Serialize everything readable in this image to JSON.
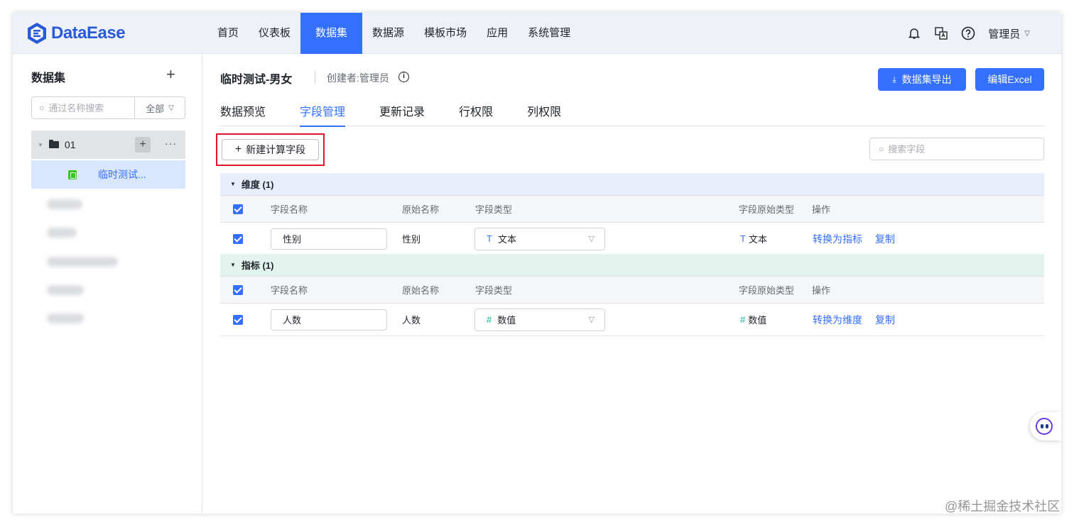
{
  "app": {
    "name": "DataEase"
  },
  "nav": {
    "items": [
      "首页",
      "仪表板",
      "数据集",
      "数据源",
      "模板市场",
      "应用",
      "系统管理"
    ],
    "active_index": 2
  },
  "topbar": {
    "user": "管理员"
  },
  "sidebar": {
    "title": "数据集",
    "search_placeholder": "通过名称搜索",
    "filter": "全部",
    "folder": {
      "name": "01"
    },
    "leaf": {
      "name": "临时测试..."
    }
  },
  "dataset": {
    "title": "临时测试-男女",
    "creator": "创建者:管理员",
    "export_button": "数据集导出",
    "excel_button": "编辑Excel"
  },
  "tabs": [
    "数据预览",
    "字段管理",
    "更新记录",
    "行权限",
    "列权限"
  ],
  "active_tab": 1,
  "toolbar": {
    "new_calc_field": "新建计算字段",
    "search_placeholder": "搜索字段"
  },
  "table_headers": {
    "field_name": "字段名称",
    "origin_name": "原始名称",
    "field_type": "字段类型",
    "origin_type": "字段原始类型",
    "actions": "操作"
  },
  "dimension": {
    "title": "维度 (1)",
    "rows": [
      {
        "field_name": "性别",
        "origin_name": "性别",
        "type_icon": "T",
        "type": "文本",
        "origin_type_icon": "T",
        "origin_type": "文本",
        "action_convert": "转换为指标",
        "action_copy": "复制"
      }
    ]
  },
  "metric": {
    "title": "指标 (1)",
    "rows": [
      {
        "field_name": "人数",
        "origin_name": "人数",
        "type_icon": "#",
        "type": "数值",
        "origin_type_icon": "#",
        "origin_type": "数值",
        "action_convert": "转换为维度",
        "action_copy": "复制"
      }
    ]
  },
  "watermark": "@稀土掘金技术社区",
  "colors": {
    "primary": "#3370ff",
    "highlight_box": "#e0162a",
    "dimension_bg": "#e8eefc",
    "metric_bg": "#e3f3ee"
  }
}
